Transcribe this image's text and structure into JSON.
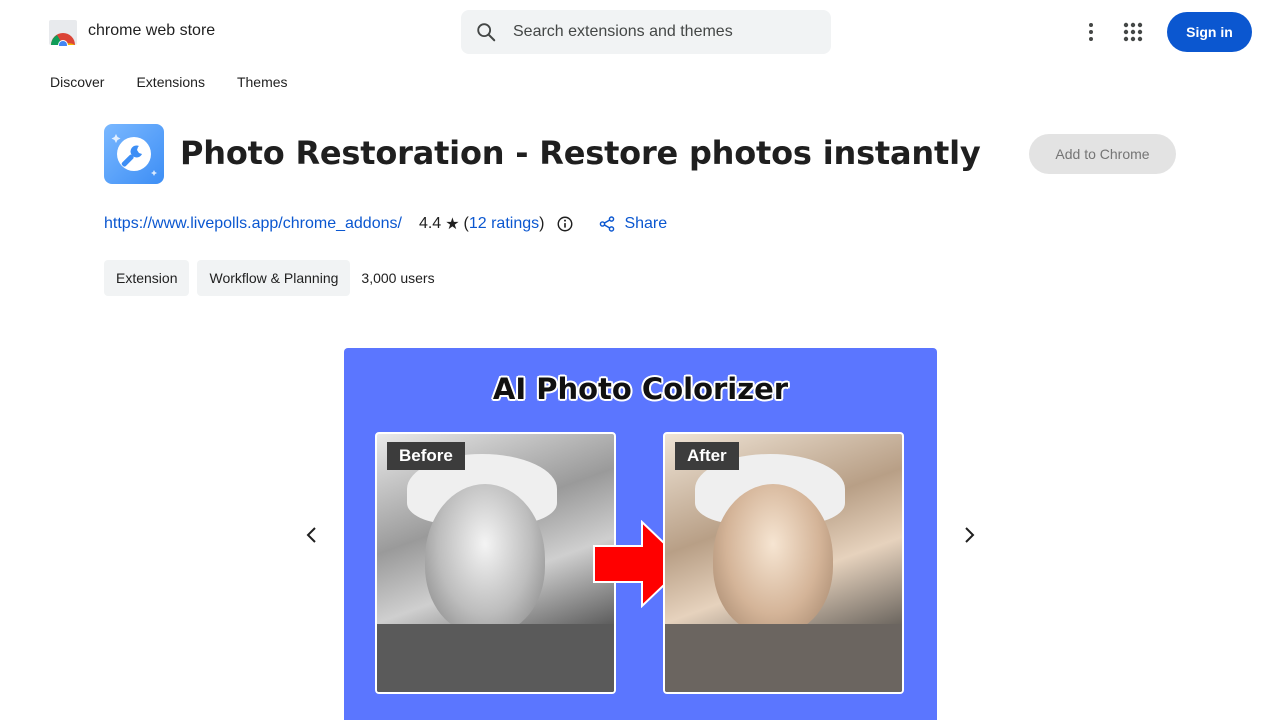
{
  "header": {
    "brand": "chrome web store",
    "search_placeholder": "Search extensions and themes",
    "sign_in": "Sign in"
  },
  "nav": {
    "items": [
      "Discover",
      "Extensions",
      "Themes"
    ]
  },
  "extension": {
    "title": "Photo Restoration - Restore photos instantly",
    "add_button": "Add to Chrome",
    "url": "https://www.livepolls.app/chrome_addons/",
    "rating": "4.4",
    "ratings_link": "12 ratings",
    "share": "Share",
    "chips": [
      "Extension",
      "Workflow & Planning"
    ],
    "users": "3,000 users"
  },
  "slide": {
    "title": "AI Photo Colorizer",
    "before_label": "Before",
    "after_label": "After",
    "background_color": "#5b76ff",
    "arrow_color": "#ff0000"
  },
  "colors": {
    "accent": "#0b57d0",
    "chip_bg": "#f1f3f4"
  }
}
